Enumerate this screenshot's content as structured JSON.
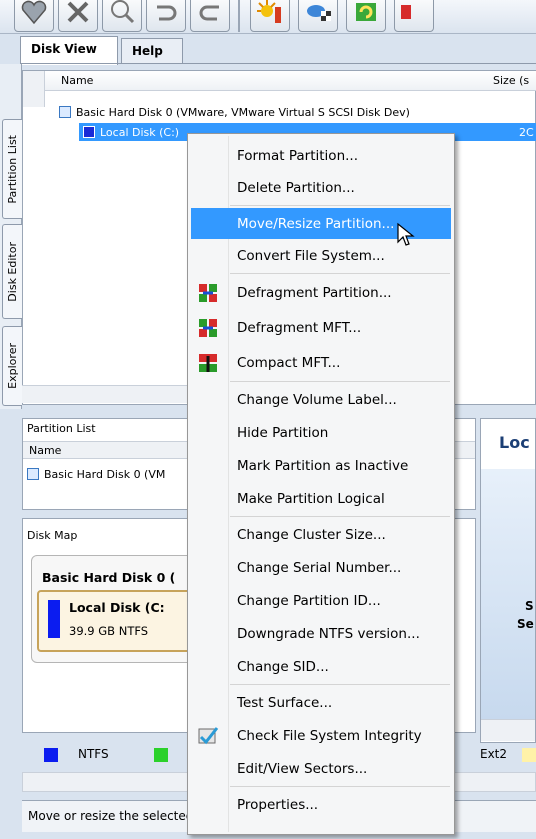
{
  "toolbar": {
    "icons": [
      "heart-icon",
      "tools-icon",
      "magnifier-icon",
      "undo-icon",
      "redo-icon",
      "burst-icon",
      "disk-flag-icon",
      "refresh-icon",
      "red-icon"
    ]
  },
  "tabs": [
    {
      "label": "Disk View",
      "active": true
    },
    {
      "label": "Help",
      "active": false
    }
  ],
  "side_tabs": [
    "Partition List",
    "Disk Editor",
    "Explorer"
  ],
  "tree": {
    "columns": {
      "name": "Name",
      "size": "Size (s"
    },
    "disk_row": "Basic Hard Disk 0 (VMware, VMware Virtual S SCSI Disk Dev)",
    "partition_row": "Local Disk (C:)",
    "partition_size": "2C"
  },
  "partition_list_panel": {
    "title": "Partition List",
    "column": "Name",
    "row": "Basic Hard Disk 0 (VM"
  },
  "disk_map": {
    "title": "Disk Map",
    "disk_label": "Basic Hard Disk 0 (",
    "partition_label": "Local Disk (C:",
    "partition_info": "39.9 GB NTFS"
  },
  "right_panel": {
    "title": "Loc",
    "line1": "S",
    "line2": "Se"
  },
  "legend": {
    "items": [
      {
        "label": "NTFS",
        "color": "#0b1cf0"
      },
      {
        "label": "Ext2",
        "color": "#2bd12b"
      }
    ],
    "extra_color": "#fff2a8"
  },
  "status": "Move or resize the selected partition",
  "context_menu": {
    "highlight_color": "#3399ff",
    "items": [
      {
        "label": "Format Partition...",
        "icon": ""
      },
      {
        "label": "Delete Partition...",
        "icon": ""
      },
      {
        "label": "Move/Resize Partition...",
        "icon": "",
        "highlighted": true
      },
      {
        "label": "Convert File System...",
        "icon": ""
      },
      {
        "label": "Defragment Partition...",
        "icon": "defrag-icon"
      },
      {
        "label": "Defragment MFT...",
        "icon": "defrag-mft-icon"
      },
      {
        "label": "Compact MFT...",
        "icon": "compact-mft-icon"
      },
      {
        "label": "Change Volume Label...",
        "icon": ""
      },
      {
        "label": "Hide Partition",
        "icon": ""
      },
      {
        "label": "Mark Partition as Inactive",
        "icon": ""
      },
      {
        "label": "Make Partition Logical",
        "icon": ""
      },
      {
        "label": "Change Cluster Size...",
        "icon": ""
      },
      {
        "label": "Change Serial Number...",
        "icon": ""
      },
      {
        "label": "Change Partition ID...",
        "icon": ""
      },
      {
        "label": "Downgrade NTFS version...",
        "icon": ""
      },
      {
        "label": "Change SID...",
        "icon": ""
      },
      {
        "label": "Test Surface...",
        "icon": ""
      },
      {
        "label": "Check File System Integrity",
        "icon": "check-fs-icon"
      },
      {
        "label": "Edit/View Sectors...",
        "icon": ""
      },
      {
        "label": "Properties...",
        "icon": ""
      }
    ]
  }
}
